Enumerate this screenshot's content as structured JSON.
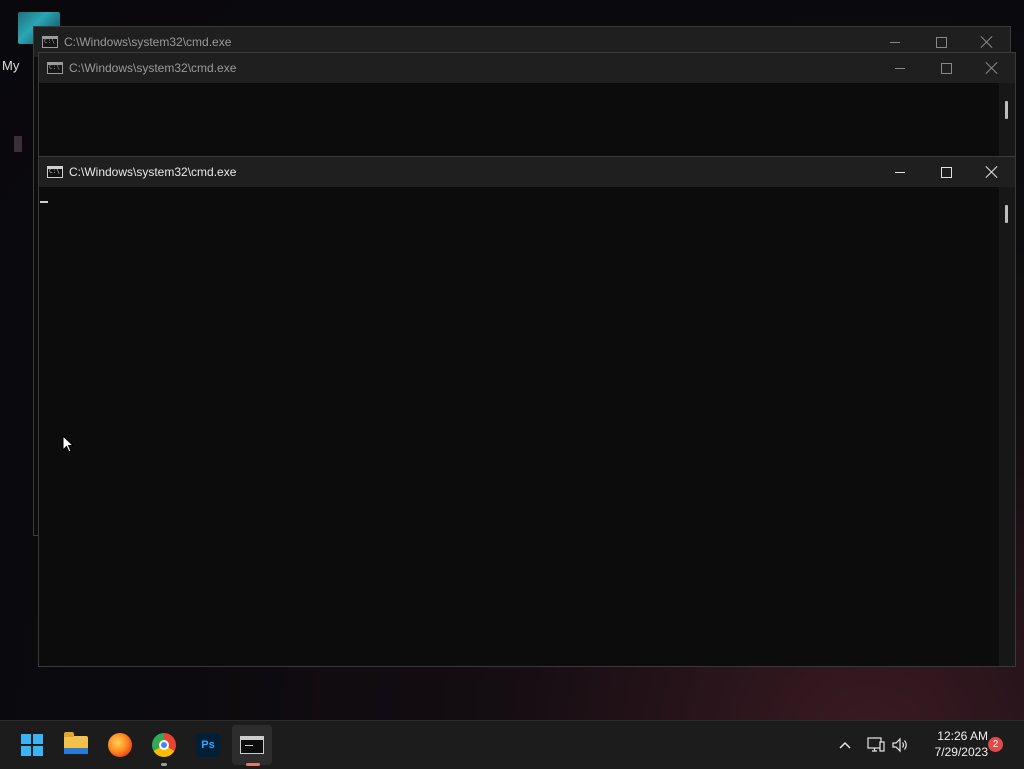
{
  "desktop": {
    "label": "My"
  },
  "windows": [
    {
      "title": "C:\\Windows\\system32\\cmd.exe",
      "state": "inactive"
    },
    {
      "title": "C:\\Windows\\system32\\cmd.exe",
      "state": "inactive"
    },
    {
      "title": "C:\\Windows\\system32\\cmd.exe",
      "state": "active"
    }
  ],
  "taskbar": {
    "apps": [
      {
        "name": "start-button",
        "icon": "windows-logo-icon"
      },
      {
        "name": "file-explorer",
        "icon": "folder-icon"
      },
      {
        "name": "firefox",
        "icon": "firefox-icon"
      },
      {
        "name": "chrome",
        "icon": "chrome-icon"
      },
      {
        "name": "photoshop",
        "icon": "photoshop-icon",
        "label": "Ps"
      },
      {
        "name": "command-prompt",
        "icon": "cmd-icon"
      }
    ],
    "tray": {
      "chevron": "^",
      "network_icon": "network-icon",
      "volume_icon": "volume-icon",
      "time": "12:26 AM",
      "date": "7/29/2023",
      "notifications": "2"
    }
  },
  "colors": {
    "accent": "#3ab4f2",
    "console_bg": "#0c0c0c",
    "titlebar_bg": "#1f1f1f",
    "taskbar_bg": "#1c1c1c",
    "running_indicator": "#e07a6a",
    "notification_badge": "#e04a4a"
  }
}
